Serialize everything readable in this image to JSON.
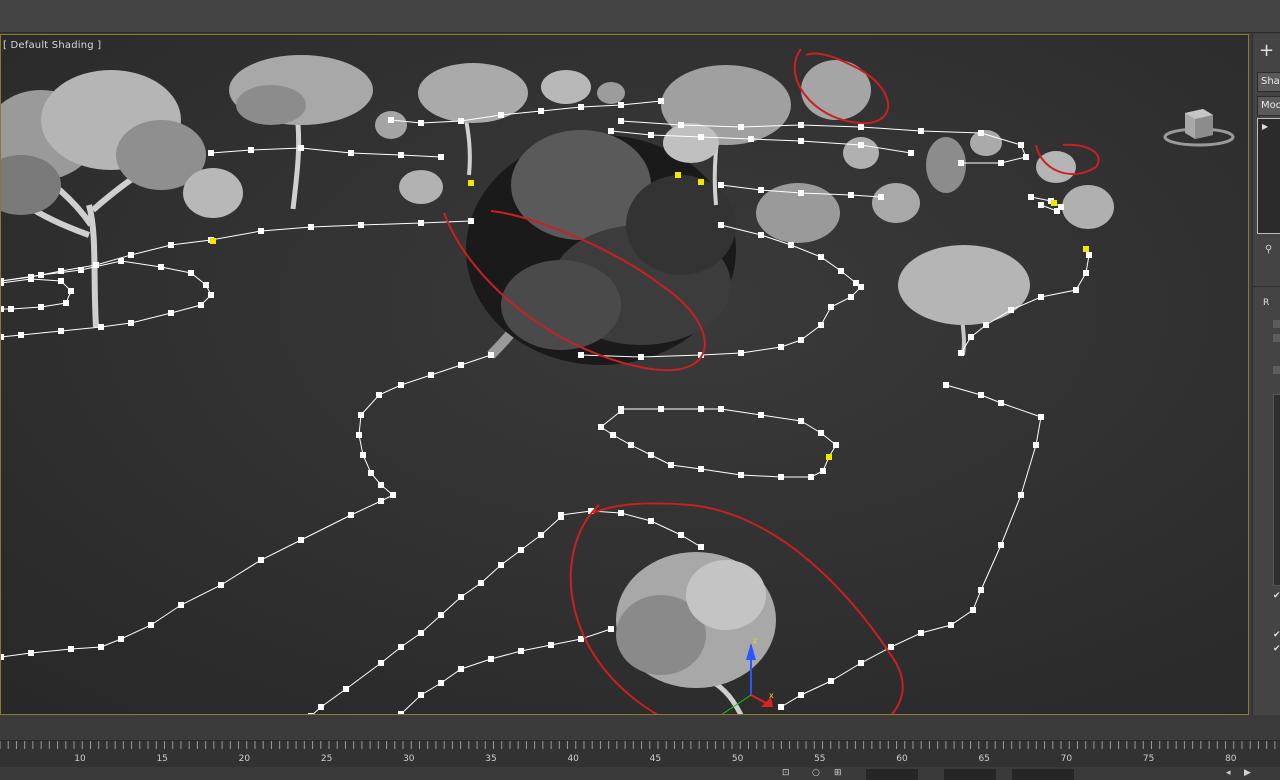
{
  "viewport": {
    "label": "[ Default Shading ]"
  },
  "command_panel": {
    "create_icon": "plus-icon",
    "tab_shapes": "Shap",
    "tab_modify": "Modi",
    "rollout_label": "R"
  },
  "timeline": {
    "tick_labels": [
      "10",
      "15",
      "20",
      "25",
      "30",
      "35",
      "40",
      "45",
      "50",
      "55",
      "60",
      "65",
      "70",
      "75",
      "80"
    ]
  },
  "colors": {
    "viewport_border": "#8a7a2e",
    "annotation": "#cc1f1f",
    "selected_vertex": "#f3e600",
    "spline": "#ffffff"
  }
}
